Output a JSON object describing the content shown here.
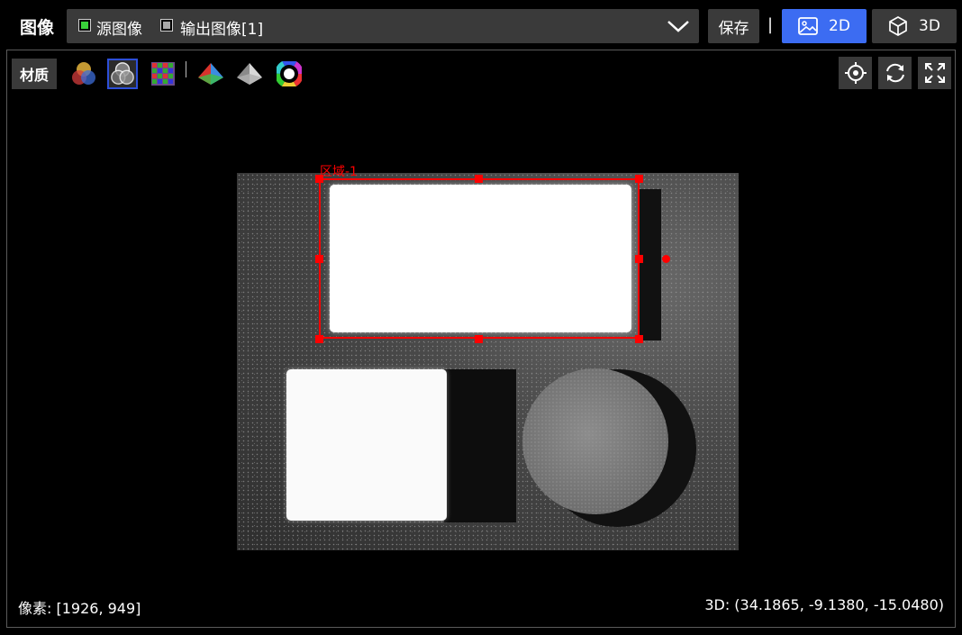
{
  "header": {
    "title": "图像",
    "source_checkbox_label": "源图像",
    "source_checked": true,
    "output_checkbox_label": "输出图像[1]",
    "output_checked": false,
    "save_label": "保存",
    "separator": "|",
    "mode_2d_label": "2D",
    "mode_3d_label": "3D",
    "active_mode": "2D",
    "accent_color": "#3c6cf2"
  },
  "toolbar": {
    "material_label": "材质",
    "tools": [
      "rgb-venn-icon",
      "mono-venn-icon",
      "color-grid-icon",
      "color-pyramid-icon",
      "gray-pyramid-icon",
      "color-wheel-icon"
    ],
    "selected_tool": "mono-venn-icon",
    "right_tools": [
      "locate-icon",
      "refresh-icon",
      "fit-screen-icon"
    ]
  },
  "roi": {
    "label": "区域-1",
    "color": "#ff0000"
  },
  "status": {
    "pixel": "像素: [1926, 949]",
    "coord_3d": "3D: (34.1865, -9.1380, -15.0480)"
  }
}
